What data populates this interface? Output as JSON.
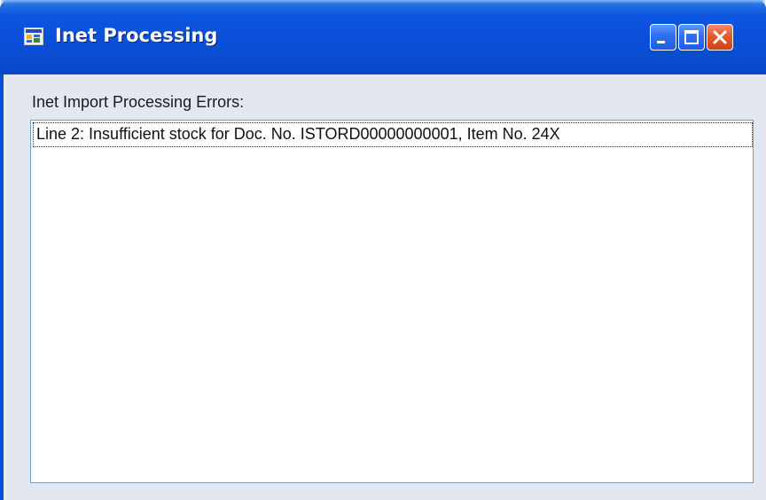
{
  "window": {
    "title": "Inet Processing",
    "icon": "app-window-icon",
    "buttons": {
      "minimize_icon": "minimize-icon",
      "maximize_icon": "maximize-icon",
      "close_icon": "close-icon"
    }
  },
  "content": {
    "errors_label": "Inet Import Processing Errors:",
    "errors": [
      "Line 2: Insufficient stock for Doc. No. ISTORD00000000001, Item No. 24X"
    ]
  },
  "colors": {
    "titlebar": "#0a4fd8",
    "close_button": "#e45b2e",
    "client_background": "#e3e7ef",
    "list_border": "#7f9db9"
  }
}
